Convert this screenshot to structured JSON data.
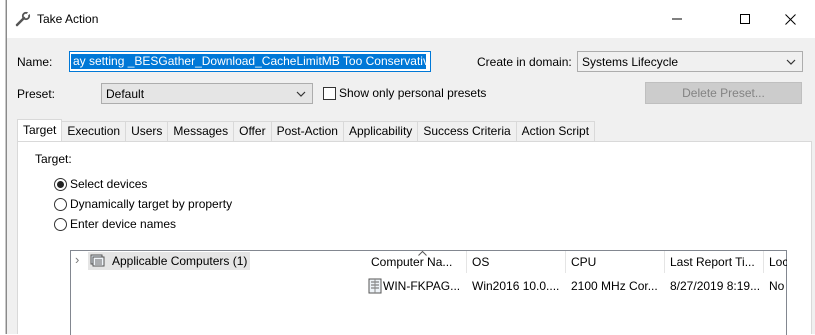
{
  "window": {
    "title": "Take Action",
    "minimize_glyph": "—",
    "maximize_glyph": "☐",
    "close_glyph": "✕"
  },
  "form": {
    "name_label": "Name:",
    "name_value": "ay setting _BESGather_Download_CacheLimitMB Too Conservative",
    "create_in_domain_label": "Create in domain:",
    "domain_value": "Systems Lifecycle",
    "preset_label": "Preset:",
    "preset_value": "Default",
    "show_personal_label": "Show only personal presets",
    "show_personal_checked": false,
    "delete_preset_label": "Delete Preset..."
  },
  "tabs": [
    {
      "label": "Target",
      "active": true
    },
    {
      "label": "Execution"
    },
    {
      "label": "Users"
    },
    {
      "label": "Messages"
    },
    {
      "label": "Offer"
    },
    {
      "label": "Post-Action"
    },
    {
      "label": "Applicability"
    },
    {
      "label": "Success Criteria"
    },
    {
      "label": "Action Script"
    }
  ],
  "target": {
    "heading": "Target:",
    "options": [
      {
        "label": "Select devices",
        "checked": true
      },
      {
        "label": "Dynamically target by property",
        "checked": false
      },
      {
        "label": "Enter device names",
        "checked": false
      }
    ],
    "tree": {
      "expander": "›",
      "item_label": "Applicable Computers (1)"
    },
    "list": {
      "columns": [
        "Computer Na...",
        "OS",
        "CPU",
        "Last Report Ti...",
        "Loc"
      ],
      "rows": [
        [
          "WIN-FKPAG...",
          "Win2016 10.0....",
          "2100 MHz Cor...",
          "8/27/2019 8:19...",
          "No"
        ]
      ]
    }
  },
  "colors": {
    "selection": "#0078d7",
    "window_bg": "#f0f0f0",
    "panel_bg": "#ffffff"
  },
  "icons": [
    "wrench-icon",
    "chevron-down-icon",
    "computer-group-icon",
    "computer-icon"
  ]
}
